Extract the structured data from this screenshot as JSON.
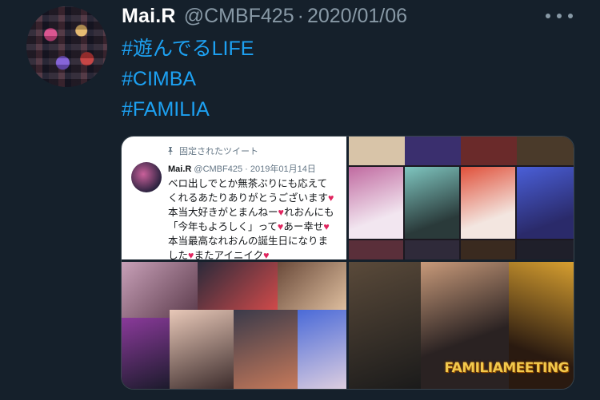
{
  "tweet": {
    "display_name": "Mai.R",
    "handle": "@CMBF425",
    "separator": "·",
    "date": "2020/01/06",
    "hashtags": [
      "#遊んでるLIFE",
      "#CIMBA",
      "#FAMILIA"
    ]
  },
  "media": {
    "embedded_tweet": {
      "pinned_label": "固定されたツイート",
      "name": "Mai.R",
      "handle": "@CMBF425",
      "date": "· 2019年01月14日",
      "text": "ベロ出しでとか無茶ぶりにも応えてくれるあたりありがとうございます♥本当大好きがとまんねー♥れおんにも「今年もよろしく」って♥あー幸せ♥本当最高なれおんの誕生日になりました♥またアイニイク♥"
    },
    "collage_caption": "FAMILIAMEETING"
  },
  "colors": {
    "background": "#15202b",
    "primary_text": "#ffffff",
    "secondary_text": "#8899a6",
    "link": "#1da1f2",
    "heart": "#e0245e"
  },
  "icons": {
    "more": "more-horizontal-icon",
    "pin": "pin-icon"
  }
}
